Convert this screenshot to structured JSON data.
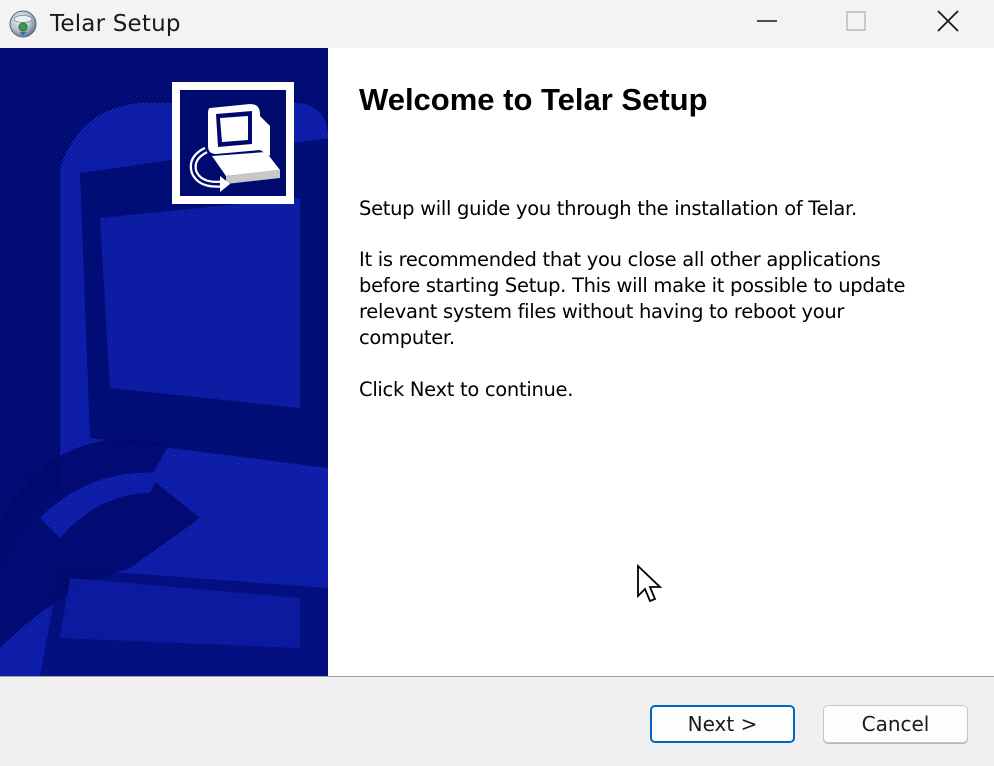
{
  "window": {
    "title": "Telar Setup",
    "app_icon": "installer-disc-icon",
    "controls": {
      "minimize_icon": "minimize-icon",
      "maximize_icon": "maximize-icon",
      "close_icon": "close-icon"
    }
  },
  "sidebar": {
    "logo_icon": "computer-install-icon",
    "background_color": "#000a6e"
  },
  "main": {
    "title": "Welcome to Telar Setup",
    "paragraph1": "Setup will guide you through the installation of Telar.",
    "paragraph2": "It is recommended that you close all other applications before starting Setup. This will make it possible to update relevant system files without having to reboot your computer.",
    "paragraph3": "Click Next to continue."
  },
  "footer": {
    "next_label": "Next >",
    "cancel_label": "Cancel"
  },
  "colors": {
    "accent": "#0067c0",
    "sidebar": "#000a6e",
    "content_bg": "#ffffff",
    "chrome_bg": "#f0f0f0"
  }
}
